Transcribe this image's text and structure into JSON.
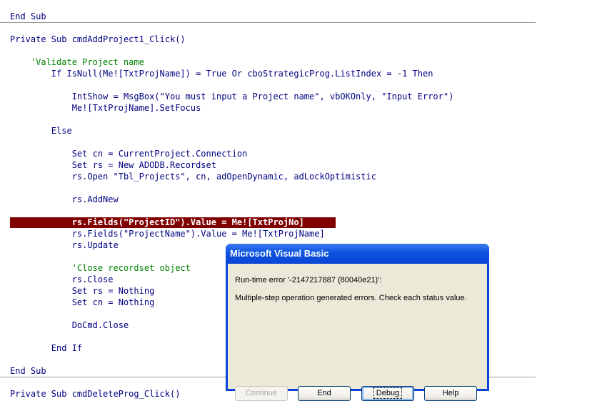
{
  "code": {
    "lines": [
      "End Sub",
      "Private Sub cmdAddProject1_Click()",
      "    'Validate Project name",
      "        If IsNull(Me![TxtProjName]) = True Or cboStrategicProg.ListIndex = -1 Then",
      "            IntShow = MsgBox(\"You must input a Project name\", vbOKOnly, \"Input Error\")",
      "            Me![TxtProjName].SetFocus",
      "        Else",
      "            Set cn = CurrentProject.Connection",
      "            Set rs = New ADODB.Recordset",
      "            rs.Open \"Tbl_Projects\", cn, adOpenDynamic, adLockOptimistic",
      "            rs.AddNew",
      "            rs.Fields(\"ProjectID\").Value = Me![TxtProjNo]",
      "            rs.Fields(\"ProjectName\").Value = Me![TxtProjName]",
      "            rs.Update",
      "            'Close recordset object",
      "            rs.Close",
      "            Set rs = Nothing",
      "            Set cn = Nothing",
      "            DoCmd.Close",
      "        End If",
      "End Sub",
      "Private Sub cmdDeleteProg_Click()"
    ]
  },
  "dialog": {
    "title": "Microsoft Visual Basic",
    "error_line": "Run-time error '-2147217887 (80040e21)':",
    "message": "Multiple-step operation generated errors. Check each status value.",
    "buttons": {
      "continue": "Continue",
      "end": "End",
      "debug": "Debug",
      "help": "Help"
    }
  },
  "colors": {
    "highlight": "#800000",
    "code_text": "#000080",
    "comment": "#008000",
    "titlebar": "#0a44d8",
    "dialog_bg": "#ece9d8"
  }
}
